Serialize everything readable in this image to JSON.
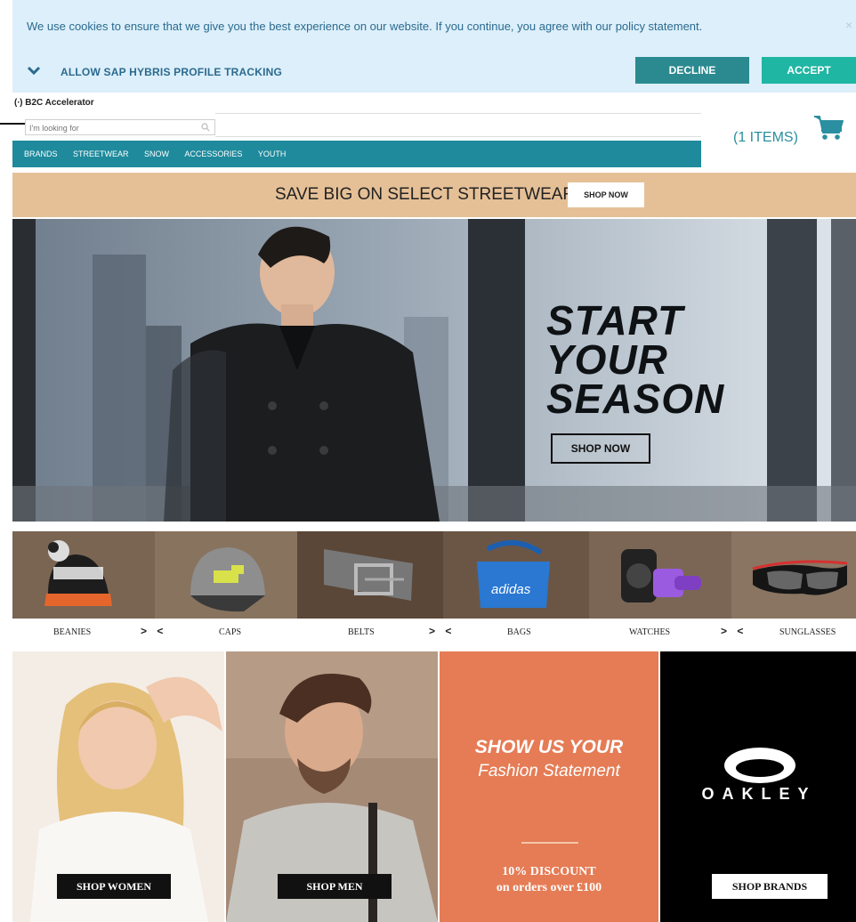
{
  "cookie": {
    "message": "We use cookies to ensure that we give you the best experience on our website. If you continue, you agree with our policy statement.",
    "close": "×",
    "tracking_label": "ALLOW SAP HYBRIS PROFILE TRACKING",
    "decline_label": "DECLINE",
    "accept_label": "ACCEPT"
  },
  "header": {
    "logo_text": "(∙) B2C Accelerator",
    "search_placeholder": "I'm looking for",
    "cart_text": "(1 ITEMS)"
  },
  "nav": {
    "items": [
      "BRANDS",
      "STREETWEAR",
      "SNOW",
      "ACCESSORIES",
      "YOUTH"
    ]
  },
  "promo": {
    "text": "SAVE BIG ON SELECT STREETWEAR",
    "button": "SHOP NOW"
  },
  "hero": {
    "line1": "START",
    "line2": "YOUR",
    "line3": "SEASON",
    "button": "SHOP NOW"
  },
  "categories": {
    "items": [
      "BEANIES",
      "CAPS",
      "BELTS",
      "BAGS",
      "WATCHES",
      "SUNGLASSES"
    ],
    "arrows": "> <",
    "bag_brand": "adidas"
  },
  "tiles": {
    "women_button": "SHOP WOMEN",
    "men_button": "SHOP MEN",
    "show_us": "SHOW US YOUR",
    "fashion": "Fashion Statement",
    "discount": "10% DISCOUNT",
    "discount_sub": "on orders over £100",
    "oakley_word": "OAKLEY",
    "brands_button": "SHOP BRANDS"
  },
  "colors": {
    "cookie_bg": "#dceffa",
    "decline": "#2b8a8f",
    "accept": "#1fb6a3",
    "nav": "#1e8a9c",
    "promo": "#e5c097",
    "orange_tile": "#e57c55"
  }
}
